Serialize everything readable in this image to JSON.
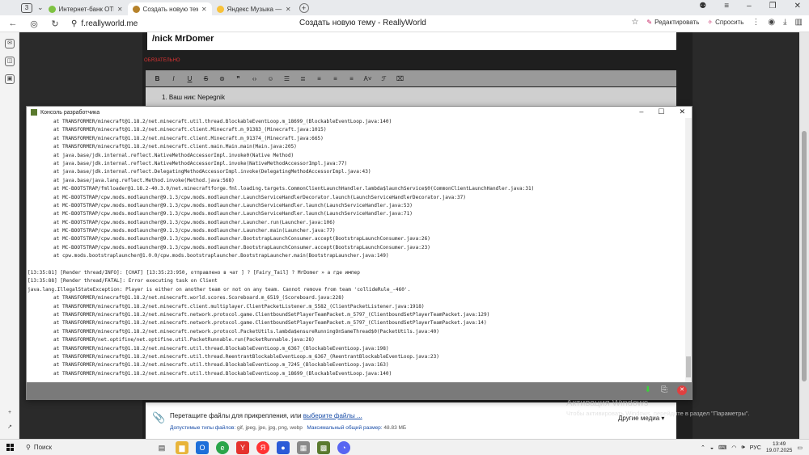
{
  "browser": {
    "tab_count": "3",
    "tabs": [
      {
        "title": "Интернет-банк ОТП Бан",
        "color": "#7ec242"
      },
      {
        "title": "Создать новую тему -",
        "color": "#b6822a"
      },
      {
        "title": "Яндекс Музыка — собир",
        "color": "#f8c23a"
      }
    ],
    "url": "f.reallyworld.me",
    "page_title": "Создать новую тему - ReallyWorld",
    "edit_label": "Редактировать",
    "ask_label": "Спросить"
  },
  "forum": {
    "topic_title": "/nick MrDomer",
    "required_label": "ОБЯЗАТЕЛЬНО",
    "editor_line": "1. Ваш ник: Nepegnik",
    "drop_text": "Перетащите файлы для прикрепления, или ",
    "drop_link": "выберите файлы ...",
    "allowed_label": "Допустимые типы файлов:",
    "allowed_types": " gif, jpeg, jpe, jpg, png, webp",
    "max_size_label": "Максимальный общий размер:",
    "max_size": " 48.83 МБ",
    "other_media": "Другие медиа ▾"
  },
  "activation": {
    "title": "Активация Windows",
    "subtitle": "Чтобы активировать Windows, перейдите в раздел \"Параметры\"."
  },
  "console": {
    "title": "Консоль разработчика",
    "lines": [
      {
        "t": "at TRANSFORMER/minecraft@1.18.2/net.minecraft.util.thread.BlockableEventLoop.m_18699_(BlockableEventLoop.java:140)",
        "ind": true
      },
      {
        "t": "at TRANSFORMER/minecraft@1.18.2/net.minecraft.client.Minecraft.m_91383_(Minecraft.java:1015)",
        "ind": true
      },
      {
        "t": "at TRANSFORMER/minecraft@1.18.2/net.minecraft.client.Minecraft.m_91374_(Minecraft.java:665)",
        "ind": true
      },
      {
        "t": "at TRANSFORMER/minecraft@1.18.2/net.minecraft.client.main.Main.main(Main.java:205)",
        "ind": true
      },
      {
        "t": "at java.base/jdk.internal.reflect.NativeMethodAccessorImpl.invoke0(Native Method)",
        "ind": true
      },
      {
        "t": "at java.base/jdk.internal.reflect.NativeMethodAccessorImpl.invoke(NativeMethodAccessorImpl.java:77)",
        "ind": true
      },
      {
        "t": "at java.base/jdk.internal.reflect.DelegatingMethodAccessorImpl.invoke(DelegatingMethodAccessorImpl.java:43)",
        "ind": true
      },
      {
        "t": "at java.base/java.lang.reflect.Method.invoke(Method.java:568)",
        "ind": true
      },
      {
        "t": "at MC-BOOTSTRAP/fmlloader@1.18.2-40.3.0/net.minecraftforge.fml.loading.targets.CommonClientLaunchHandler.lambda$launchService$0(CommonClientLaunchHandler.java:31)",
        "ind": true
      },
      {
        "t": "at MC-BOOTSTRAP/cpw.mods.modlauncher@9.1.3/cpw.mods.modlauncher.LaunchServiceHandlerDecorator.launch(LaunchServiceHandlerDecorator.java:37)",
        "ind": true
      },
      {
        "t": "at MC-BOOTSTRAP/cpw.mods.modlauncher@9.1.3/cpw.mods.modlauncher.LaunchServiceHandler.launch(LaunchServiceHandler.java:53)",
        "ind": true
      },
      {
        "t": "at MC-BOOTSTRAP/cpw.mods.modlauncher@9.1.3/cpw.mods.modlauncher.LaunchServiceHandler.launch(LaunchServiceHandler.java:71)",
        "ind": true
      },
      {
        "t": "at MC-BOOTSTRAP/cpw.mods.modlauncher@9.1.3/cpw.mods.modlauncher.Launcher.run(Launcher.java:106)",
        "ind": true
      },
      {
        "t": "at MC-BOOTSTRAP/cpw.mods.modlauncher@9.1.3/cpw.mods.modlauncher.Launcher.main(Launcher.java:77)",
        "ind": true
      },
      {
        "t": "at MC-BOOTSTRAP/cpw.mods.modlauncher@9.1.3/cpw.mods.modlauncher.BootstrapLaunchConsumer.accept(BootstrapLaunchConsumer.java:26)",
        "ind": true
      },
      {
        "t": "at MC-BOOTSTRAP/cpw.mods.modlauncher@9.1.3/cpw.mods.modlauncher.BootstrapLaunchConsumer.accept(BootstrapLaunchConsumer.java:23)",
        "ind": true
      },
      {
        "t": "at cpw.mods.bootstraplauncher@1.0.0/cpw.mods.bootstraplauncher.BootstrapLauncher.main(BootstrapLauncher.java:149)",
        "ind": true
      },
      {
        "t": "",
        "ind": false
      },
      {
        "t": "[13:35:81] [Render thread/INFO]: [CHAT] [13:35:23:950, отправлено в чат ] ? [Fairy_Tail] ? MrDomer » а где импер",
        "ind": false
      },
      {
        "t": "[13:35:88] [Render thread/FATAL]: Error executing task on Client",
        "ind": false
      },
      {
        "t": "java.lang.IllegalStateException: Player is either on another team or not on any team. Cannot remove from team 'collideRule_-460'.",
        "ind": false
      },
      {
        "t": "at TRANSFORMER/minecraft@1.18.2/net.minecraft.world.scores.Scoreboard.m_6519_(Scoreboard.java:228)",
        "ind": true
      },
      {
        "t": "at TRANSFORMER/minecraft@1.18.2/net.minecraft.client.multiplayer.ClientPacketListener.m_5582_(ClientPacketListener.java:1918)",
        "ind": true
      },
      {
        "t": "at TRANSFORMER/minecraft@1.18.2/net.minecraft.network.protocol.game.ClientboundSetPlayerTeamPacket.m_5797_(ClientboundSetPlayerTeamPacket.java:129)",
        "ind": true
      },
      {
        "t": "at TRANSFORMER/minecraft@1.18.2/net.minecraft.network.protocol.game.ClientboundSetPlayerTeamPacket.m_5797_(ClientboundSetPlayerTeamPacket.java:14)",
        "ind": true
      },
      {
        "t": "at TRANSFORMER/minecraft@1.18.2/net.minecraft.network.protocol.PacketUtils.lambda$ensureRunningOnSameThread$0(PacketUtils.java:40)",
        "ind": true
      },
      {
        "t": "at TRANSFORMER/net.optifine/net.optifine.util.PacketRunnable.run(PacketRunnable.java:28)",
        "ind": true
      },
      {
        "t": "at TRANSFORMER/minecraft@1.18.2/net.minecraft.util.thread.BlockableEventLoop.m_6367_(BlockableEventLoop.java:198)",
        "ind": true
      },
      {
        "t": "at TRANSFORMER/minecraft@1.18.2/net.minecraft.util.thread.ReentrantBlockableEventLoop.m_6367_(ReentrantBlockableEventLoop.java:23)",
        "ind": true
      },
      {
        "t": "at TRANSFORMER/minecraft@1.18.2/net.minecraft.util.thread.BlockableEventLoop.m_7245_(BlockableEventLoop.java:163)",
        "ind": true
      },
      {
        "t": "at TRANSFORMER/minecraft@1.18.2/net.minecraft.util.thread.BlockableEventLoop.m_18699_(BlockableEventLoop.java:140)",
        "ind": true
      }
    ]
  },
  "taskbar": {
    "search_label": "Поиск",
    "language": "РУС",
    "time": "13:49",
    "date": "19.07.2025"
  }
}
